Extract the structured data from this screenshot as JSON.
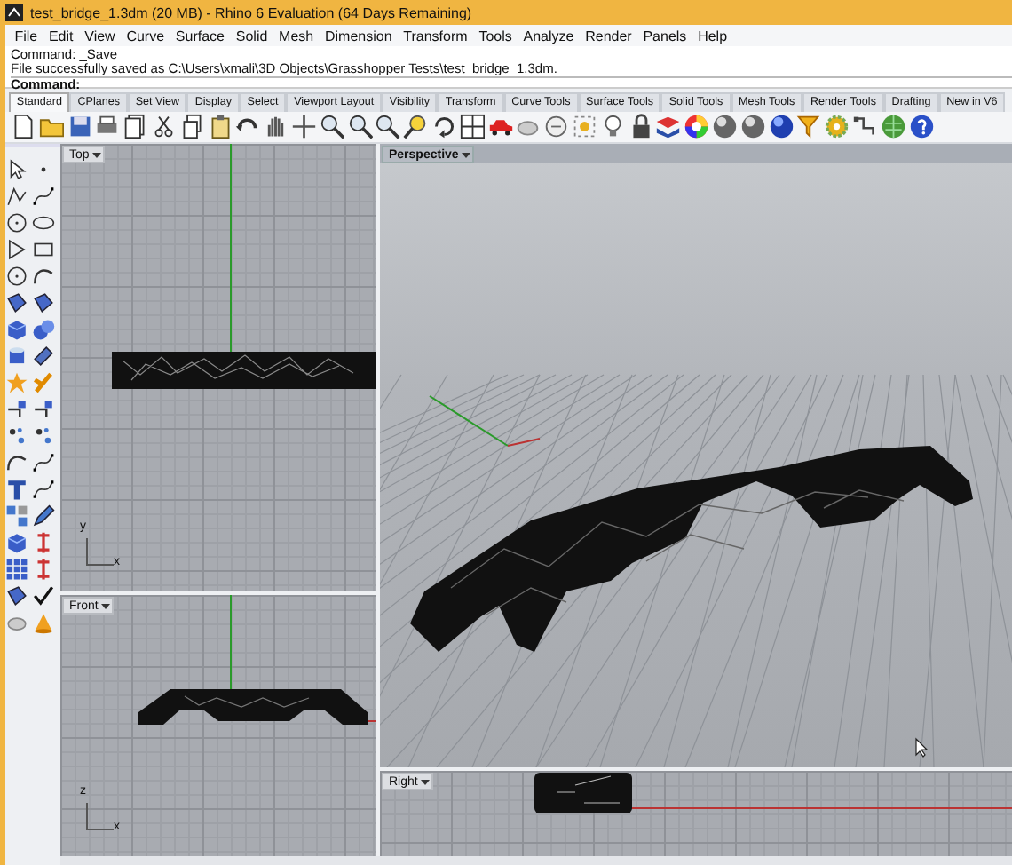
{
  "window": {
    "title": "test_bridge_1.3dm (20 MB) - Rhino 6 Evaluation (64 Days Remaining)"
  },
  "menu": [
    "File",
    "Edit",
    "View",
    "Curve",
    "Surface",
    "Solid",
    "Mesh",
    "Dimension",
    "Transform",
    "Tools",
    "Analyze",
    "Render",
    "Panels",
    "Help"
  ],
  "command_history": [
    "Command: _Save",
    "File successfully saved as C:\\Users\\xmali\\3D Objects\\Grasshopper Tests\\test_bridge_1.3dm."
  ],
  "command_prompt": "Command:",
  "tabs": [
    {
      "label": "Standard",
      "selected": true
    },
    {
      "label": "CPlanes",
      "selected": false
    },
    {
      "label": "Set View",
      "selected": false
    },
    {
      "label": "Display",
      "selected": false
    },
    {
      "label": "Select",
      "selected": false
    },
    {
      "label": "Viewport Layout",
      "selected": false
    },
    {
      "label": "Visibility",
      "selected": false
    },
    {
      "label": "Transform",
      "selected": false
    },
    {
      "label": "Curve Tools",
      "selected": false
    },
    {
      "label": "Surface Tools",
      "selected": false
    },
    {
      "label": "Solid Tools",
      "selected": false
    },
    {
      "label": "Mesh Tools",
      "selected": false
    },
    {
      "label": "Render Tools",
      "selected": false
    },
    {
      "label": "Drafting",
      "selected": false
    },
    {
      "label": "New in V6",
      "selected": false
    }
  ],
  "viewports": [
    {
      "kind": "top",
      "label": "Top",
      "selected": false,
      "axes": [
        "y",
        "x"
      ]
    },
    {
      "kind": "front",
      "label": "Front",
      "selected": false,
      "axes": [
        "z",
        "x"
      ]
    },
    {
      "kind": "perspective",
      "label": "Perspective",
      "selected": true
    },
    {
      "kind": "right",
      "label": "Right",
      "selected": false
    }
  ]
}
